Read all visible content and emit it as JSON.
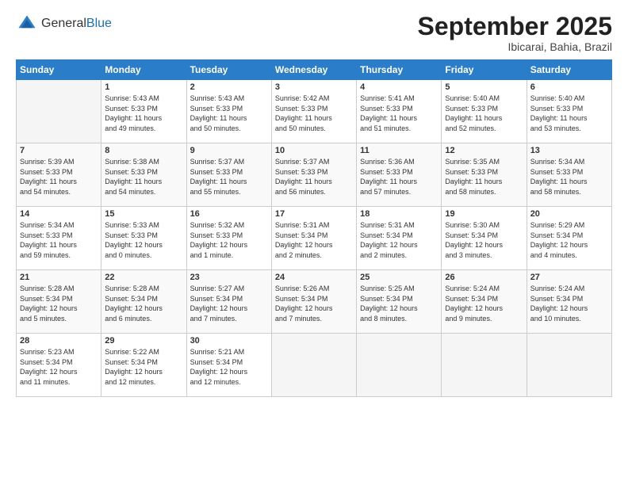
{
  "logo": {
    "general": "General",
    "blue": "Blue"
  },
  "header": {
    "month": "September 2025",
    "location": "Ibicarai, Bahia, Brazil"
  },
  "weekdays": [
    "Sunday",
    "Monday",
    "Tuesday",
    "Wednesday",
    "Thursday",
    "Friday",
    "Saturday"
  ],
  "weeks": [
    [
      {
        "day": "",
        "info": ""
      },
      {
        "day": "1",
        "info": "Sunrise: 5:43 AM\nSunset: 5:33 PM\nDaylight: 11 hours\nand 49 minutes."
      },
      {
        "day": "2",
        "info": "Sunrise: 5:43 AM\nSunset: 5:33 PM\nDaylight: 11 hours\nand 50 minutes."
      },
      {
        "day": "3",
        "info": "Sunrise: 5:42 AM\nSunset: 5:33 PM\nDaylight: 11 hours\nand 50 minutes."
      },
      {
        "day": "4",
        "info": "Sunrise: 5:41 AM\nSunset: 5:33 PM\nDaylight: 11 hours\nand 51 minutes."
      },
      {
        "day": "5",
        "info": "Sunrise: 5:40 AM\nSunset: 5:33 PM\nDaylight: 11 hours\nand 52 minutes."
      },
      {
        "day": "6",
        "info": "Sunrise: 5:40 AM\nSunset: 5:33 PM\nDaylight: 11 hours\nand 53 minutes."
      }
    ],
    [
      {
        "day": "7",
        "info": "Sunrise: 5:39 AM\nSunset: 5:33 PM\nDaylight: 11 hours\nand 54 minutes."
      },
      {
        "day": "8",
        "info": "Sunrise: 5:38 AM\nSunset: 5:33 PM\nDaylight: 11 hours\nand 54 minutes."
      },
      {
        "day": "9",
        "info": "Sunrise: 5:37 AM\nSunset: 5:33 PM\nDaylight: 11 hours\nand 55 minutes."
      },
      {
        "day": "10",
        "info": "Sunrise: 5:37 AM\nSunset: 5:33 PM\nDaylight: 11 hours\nand 56 minutes."
      },
      {
        "day": "11",
        "info": "Sunrise: 5:36 AM\nSunset: 5:33 PM\nDaylight: 11 hours\nand 57 minutes."
      },
      {
        "day": "12",
        "info": "Sunrise: 5:35 AM\nSunset: 5:33 PM\nDaylight: 11 hours\nand 58 minutes."
      },
      {
        "day": "13",
        "info": "Sunrise: 5:34 AM\nSunset: 5:33 PM\nDaylight: 11 hours\nand 58 minutes."
      }
    ],
    [
      {
        "day": "14",
        "info": "Sunrise: 5:34 AM\nSunset: 5:33 PM\nDaylight: 11 hours\nand 59 minutes."
      },
      {
        "day": "15",
        "info": "Sunrise: 5:33 AM\nSunset: 5:33 PM\nDaylight: 12 hours\nand 0 minutes."
      },
      {
        "day": "16",
        "info": "Sunrise: 5:32 AM\nSunset: 5:33 PM\nDaylight: 12 hours\nand 1 minute."
      },
      {
        "day": "17",
        "info": "Sunrise: 5:31 AM\nSunset: 5:34 PM\nDaylight: 12 hours\nand 2 minutes."
      },
      {
        "day": "18",
        "info": "Sunrise: 5:31 AM\nSunset: 5:34 PM\nDaylight: 12 hours\nand 2 minutes."
      },
      {
        "day": "19",
        "info": "Sunrise: 5:30 AM\nSunset: 5:34 PM\nDaylight: 12 hours\nand 3 minutes."
      },
      {
        "day": "20",
        "info": "Sunrise: 5:29 AM\nSunset: 5:34 PM\nDaylight: 12 hours\nand 4 minutes."
      }
    ],
    [
      {
        "day": "21",
        "info": "Sunrise: 5:28 AM\nSunset: 5:34 PM\nDaylight: 12 hours\nand 5 minutes."
      },
      {
        "day": "22",
        "info": "Sunrise: 5:28 AM\nSunset: 5:34 PM\nDaylight: 12 hours\nand 6 minutes."
      },
      {
        "day": "23",
        "info": "Sunrise: 5:27 AM\nSunset: 5:34 PM\nDaylight: 12 hours\nand 7 minutes."
      },
      {
        "day": "24",
        "info": "Sunrise: 5:26 AM\nSunset: 5:34 PM\nDaylight: 12 hours\nand 7 minutes."
      },
      {
        "day": "25",
        "info": "Sunrise: 5:25 AM\nSunset: 5:34 PM\nDaylight: 12 hours\nand 8 minutes."
      },
      {
        "day": "26",
        "info": "Sunrise: 5:24 AM\nSunset: 5:34 PM\nDaylight: 12 hours\nand 9 minutes."
      },
      {
        "day": "27",
        "info": "Sunrise: 5:24 AM\nSunset: 5:34 PM\nDaylight: 12 hours\nand 10 minutes."
      }
    ],
    [
      {
        "day": "28",
        "info": "Sunrise: 5:23 AM\nSunset: 5:34 PM\nDaylight: 12 hours\nand 11 minutes."
      },
      {
        "day": "29",
        "info": "Sunrise: 5:22 AM\nSunset: 5:34 PM\nDaylight: 12 hours\nand 12 minutes."
      },
      {
        "day": "30",
        "info": "Sunrise: 5:21 AM\nSunset: 5:34 PM\nDaylight: 12 hours\nand 12 minutes."
      },
      {
        "day": "",
        "info": ""
      },
      {
        "day": "",
        "info": ""
      },
      {
        "day": "",
        "info": ""
      },
      {
        "day": "",
        "info": ""
      }
    ]
  ]
}
